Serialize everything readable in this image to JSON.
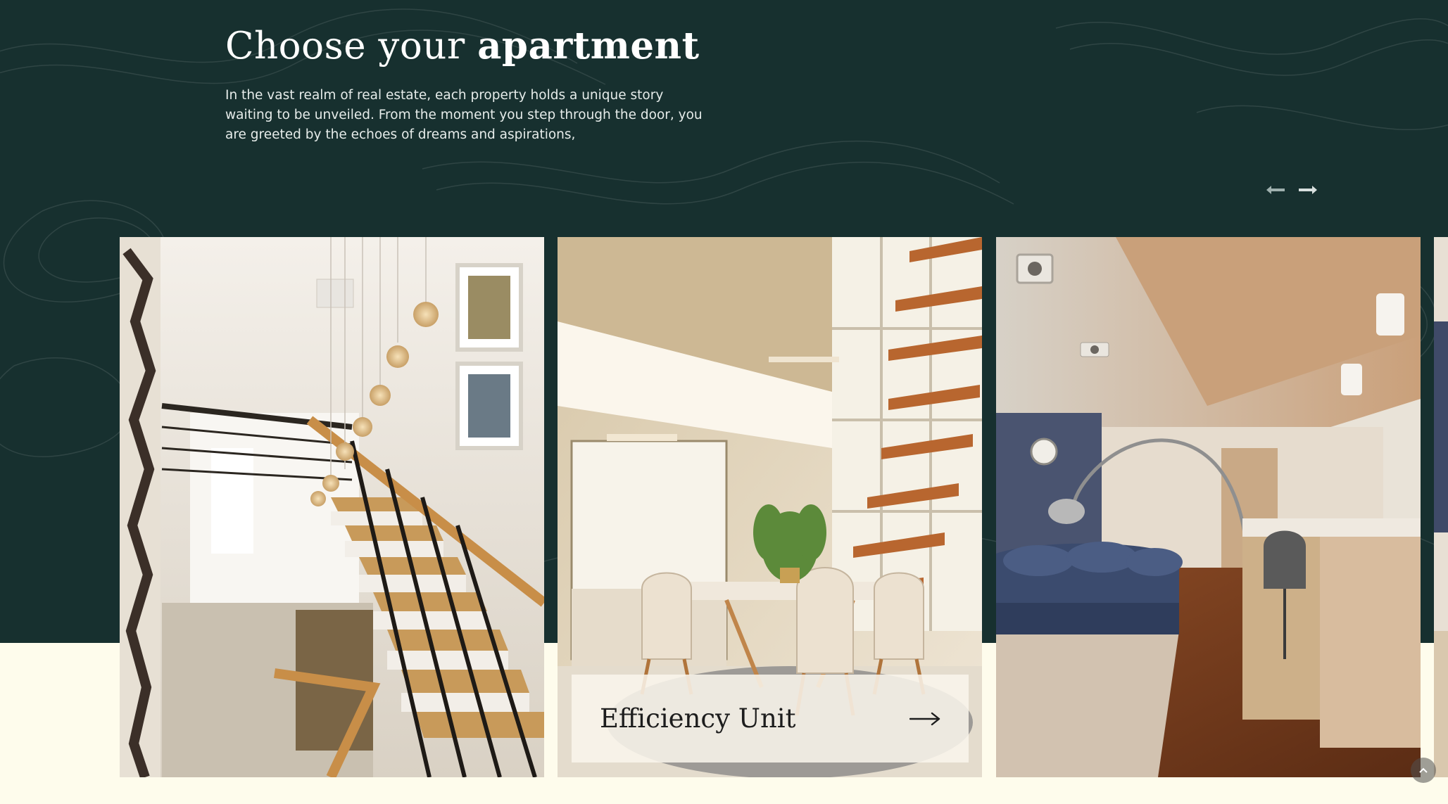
{
  "header": {
    "title_regular": "Choose your ",
    "title_bold": "apartment",
    "description": "In the vast realm of real estate, each property holds a unique story waiting to be unveiled. From the moment you step through the door, you are greeted by the echoes of dreams and aspirations,"
  },
  "slider": {
    "prev_icon": "arrow-left-icon",
    "next_icon": "arrow-right-icon",
    "cards": [
      {
        "image": "staircase-with-pendant-lights"
      },
      {
        "image": "dining-room-with-floating-stairs",
        "label": "Efficiency Unit",
        "icon": "arrow-right-icon"
      },
      {
        "image": "living-room-with-blue-sofa"
      },
      {
        "image": "partial-next-card"
      }
    ]
  },
  "scroll_top_icon": "chevron-up-icon",
  "colors": {
    "hero_bg": "#17302f",
    "page_bg": "#fefcec",
    "text_light": "#ffffff",
    "card_label_bg": "#faf6ec"
  }
}
